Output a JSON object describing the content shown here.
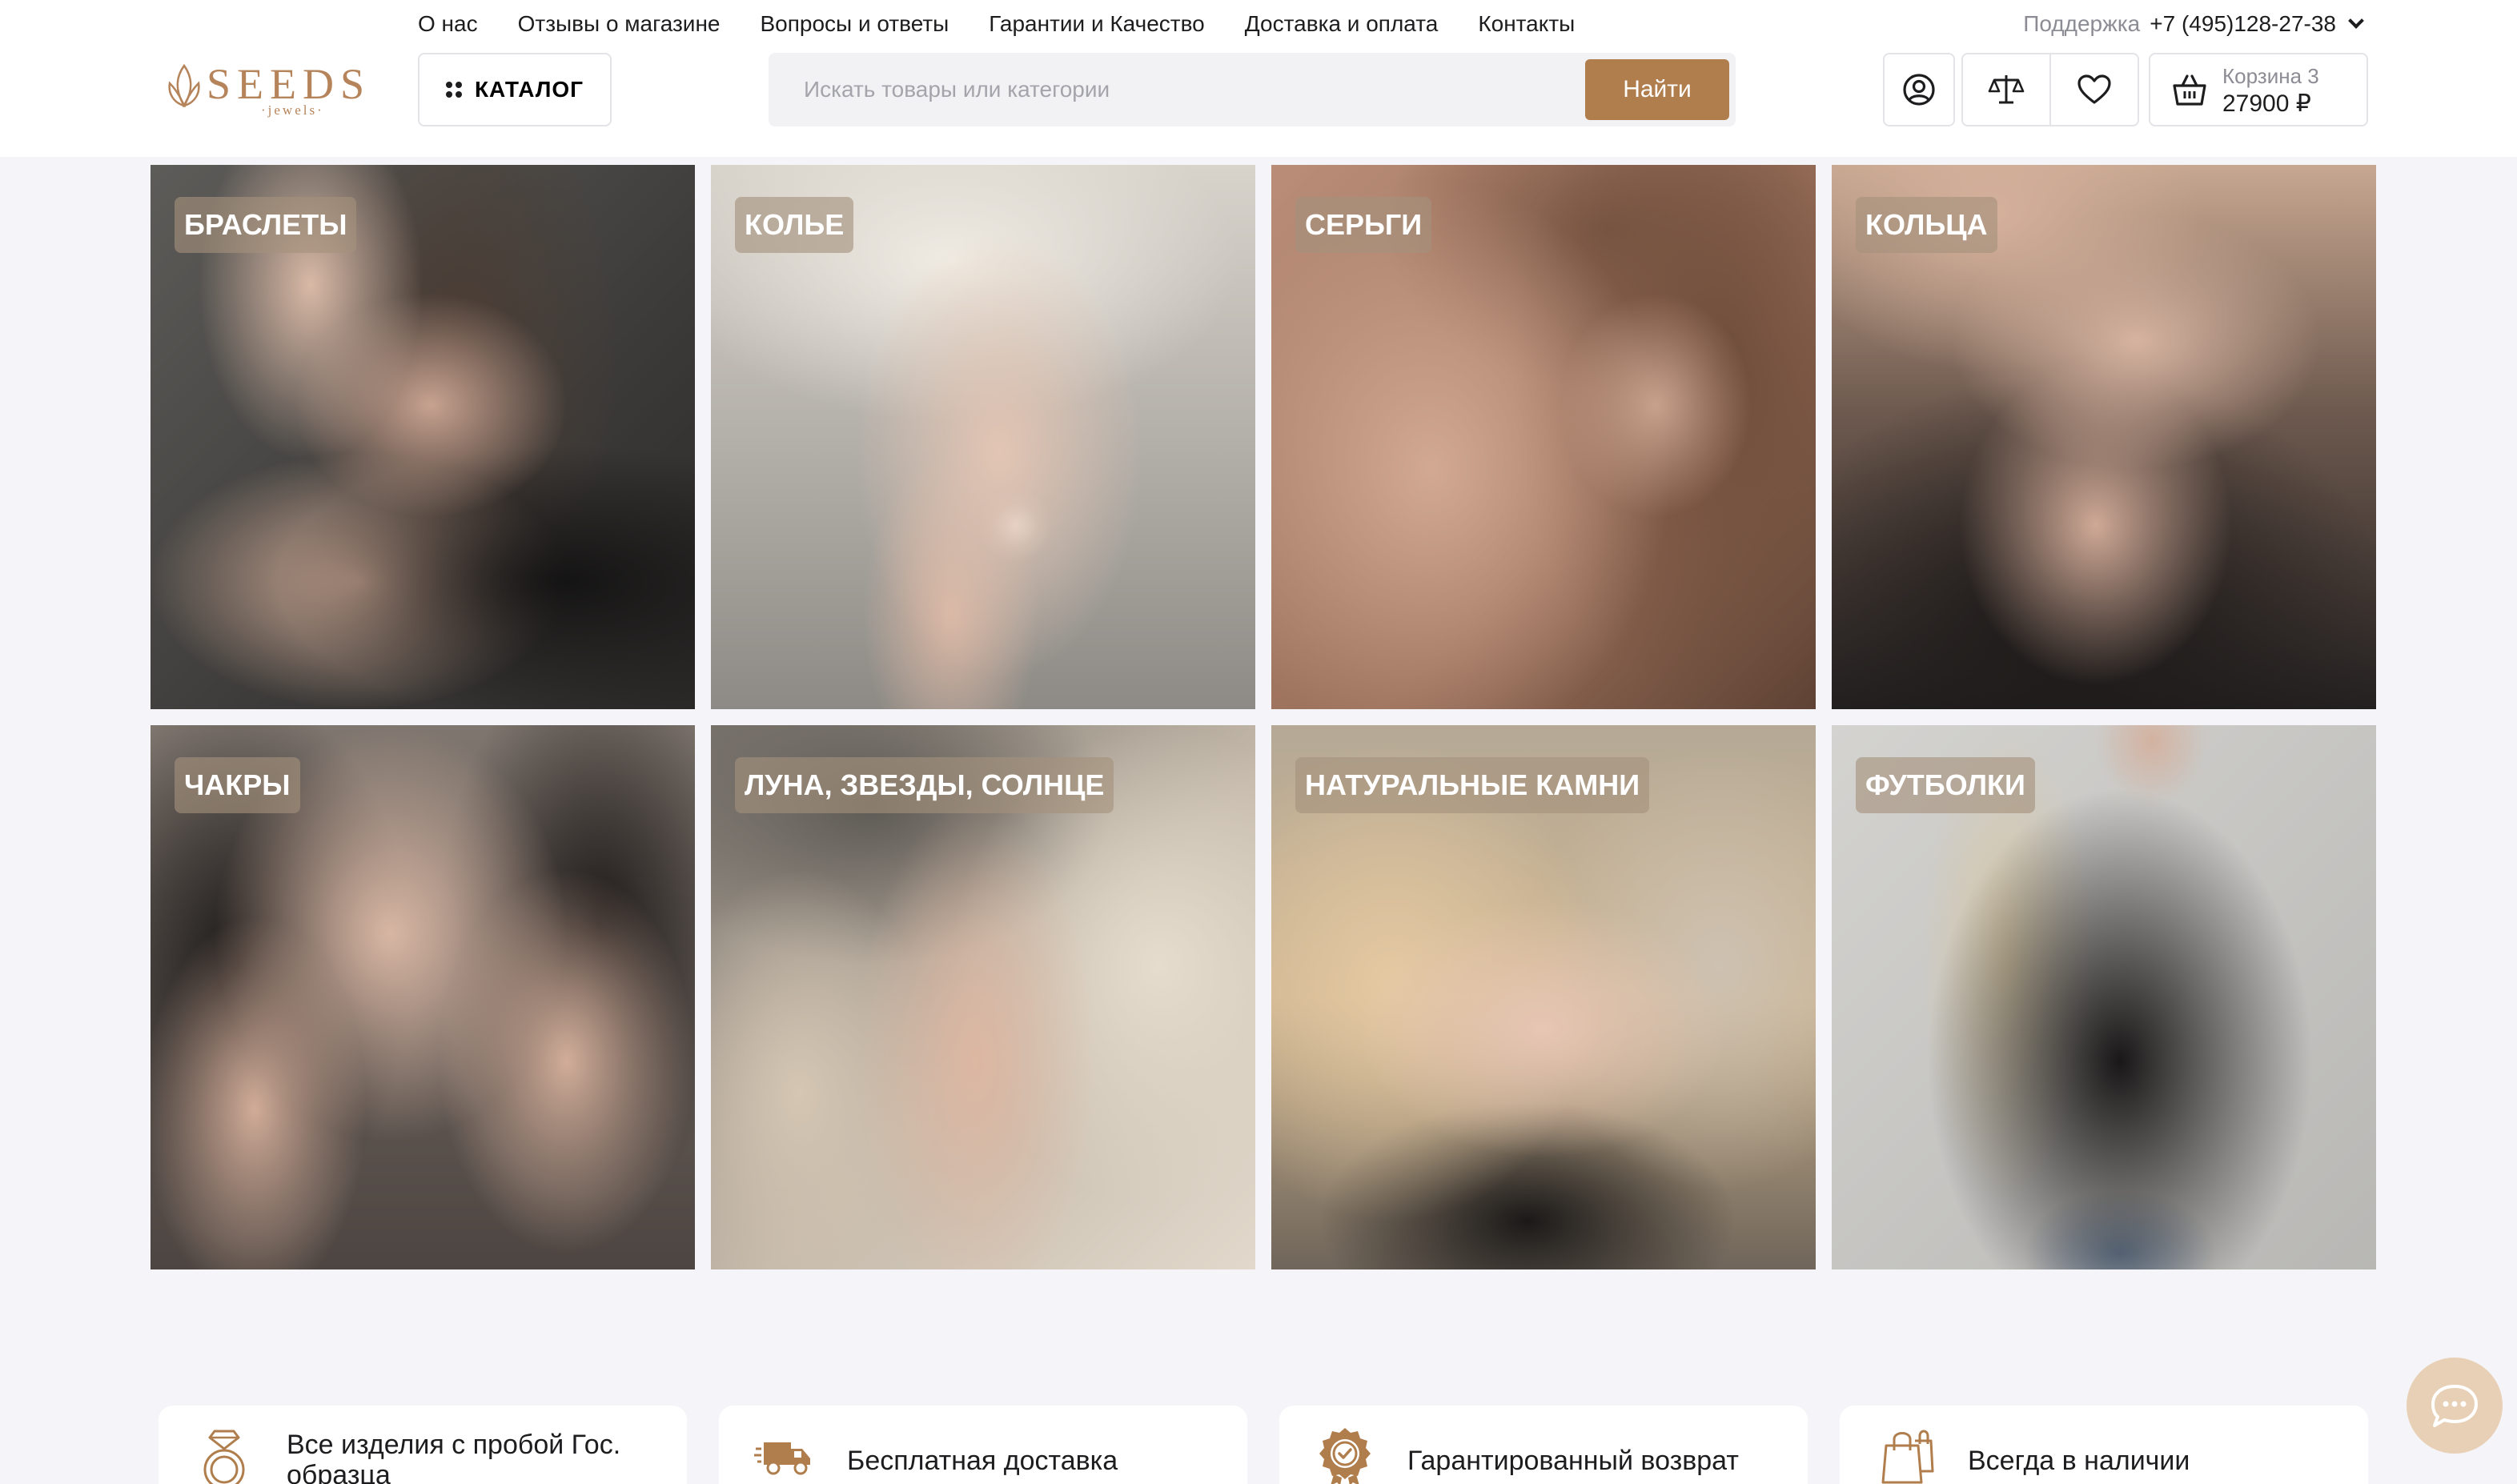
{
  "nav": {
    "items": [
      "О нас",
      "Отзывы о магазине",
      "Вопросы и ответы",
      "Гарантии и Качество",
      "Доставка и оплата",
      "Контакты"
    ]
  },
  "support": {
    "label": "Поддержка",
    "phone": "+7 (495)128-27-38"
  },
  "logo": {
    "word": "SEEDS",
    "sub": "·jewels·"
  },
  "catalog": {
    "label": "КАТАЛОГ"
  },
  "search": {
    "placeholder": "Искать товары или категории",
    "button": "Найти"
  },
  "cart": {
    "label": "Корзина 3",
    "total": "27900 ₽"
  },
  "categories": [
    {
      "label": "БРАСЛЕТЫ"
    },
    {
      "label": "КОЛЬЕ"
    },
    {
      "label": "СЕРЬГИ"
    },
    {
      "label": "КОЛЬЦА"
    },
    {
      "label": "ЧАКРЫ"
    },
    {
      "label": "ЛУНА, ЗВЕЗДЫ, СОЛНЦЕ"
    },
    {
      "label": "НАТУРАЛЬНЫЕ КАМНИ"
    },
    {
      "label": "ФУТБОЛКИ"
    }
  ],
  "advantages": [
    {
      "text": "Все изделия с пробой Гос. образца",
      "icon": "ring-icon"
    },
    {
      "text": "Бесплатная доставка",
      "icon": "truck-icon"
    },
    {
      "text": "Гарантированный возврат",
      "icon": "guarantee-badge-icon"
    },
    {
      "text": "Всегда в наличии",
      "icon": "shopping-bag-icon"
    }
  ],
  "colors": {
    "accent": "#b07d4c",
    "logo": "#b5845a",
    "chat": "#e8d0b6",
    "background": "#f5f5f9"
  }
}
